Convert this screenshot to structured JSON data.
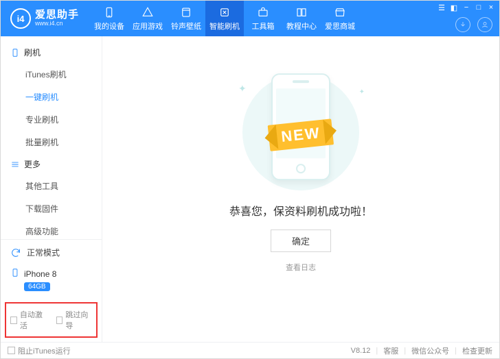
{
  "brand": {
    "name": "爱思助手",
    "url": "www.i4.cn",
    "logo_text": "i4"
  },
  "topnav": [
    {
      "key": "device",
      "label": "我的设备"
    },
    {
      "key": "games",
      "label": "应用游戏"
    },
    {
      "key": "ring",
      "label": "铃声壁纸"
    },
    {
      "key": "flash",
      "label": "智能刷机",
      "active": true
    },
    {
      "key": "toolbox",
      "label": "工具箱"
    },
    {
      "key": "tutorial",
      "label": "教程中心"
    },
    {
      "key": "mall",
      "label": "爱思商城"
    }
  ],
  "sidebar": {
    "group1": {
      "title": "刷机",
      "items": [
        {
          "key": "itunes",
          "label": "iTunes刷机"
        },
        {
          "key": "oneclick",
          "label": "一键刷机",
          "active": true
        },
        {
          "key": "pro",
          "label": "专业刷机"
        },
        {
          "key": "batch",
          "label": "批量刷机"
        }
      ]
    },
    "group2": {
      "title": "更多",
      "items": [
        {
          "key": "other",
          "label": "其他工具"
        },
        {
          "key": "fw",
          "label": "下载固件"
        },
        {
          "key": "adv",
          "label": "高级功能"
        }
      ]
    }
  },
  "mode": {
    "label": "正常模式"
  },
  "device": {
    "name": "iPhone 8",
    "storage": "64GB"
  },
  "checks": {
    "auto_activate": "自动激活",
    "skip_guide": "跳过向导"
  },
  "main": {
    "illus_banner": "NEW",
    "success": "恭喜您，保资料刷机成功啦！",
    "ok": "确定",
    "view_log": "查看日志"
  },
  "footer": {
    "block_itunes": "阻止iTunes运行",
    "version": "V8.12",
    "support": "客服",
    "wechat": "微信公众号",
    "update": "检查更新"
  }
}
